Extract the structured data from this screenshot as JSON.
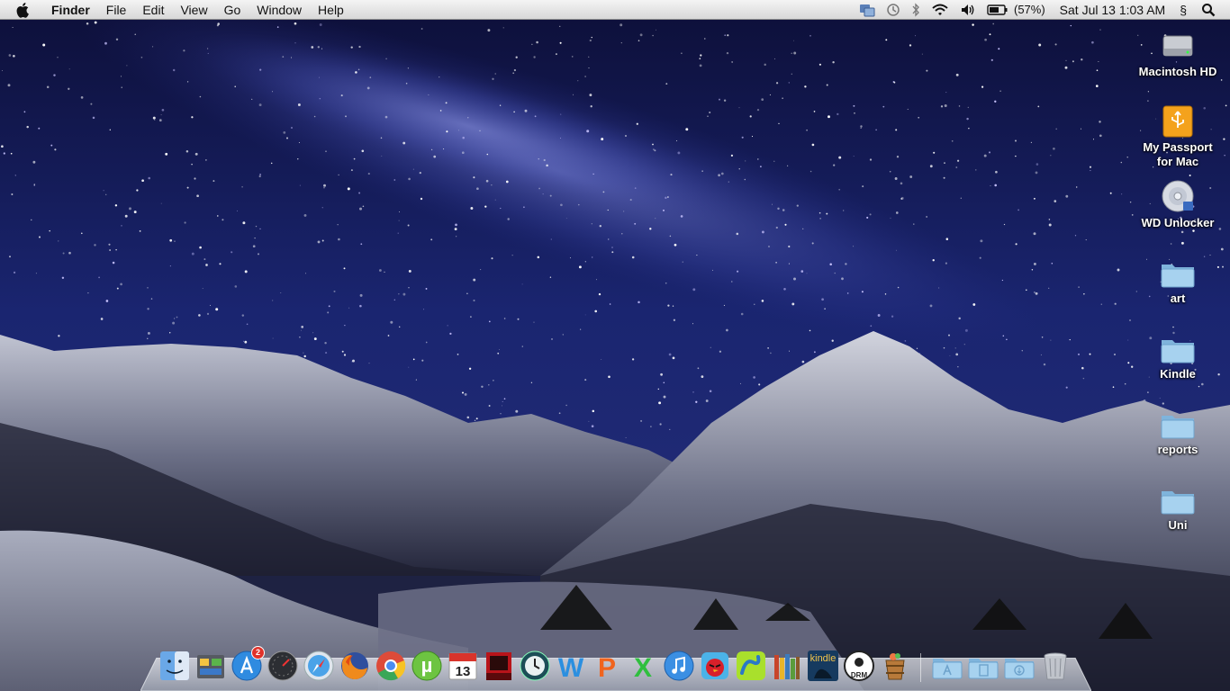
{
  "menubar": {
    "app_name": "Finder",
    "menus": [
      "File",
      "Edit",
      "View",
      "Go",
      "Window",
      "Help"
    ],
    "status": {
      "battery": "(57%)",
      "datetime": "Sat Jul 13  1:03 AM",
      "input_symbol": "§"
    }
  },
  "desktop": {
    "icons": [
      {
        "label": "Macintosh HD",
        "icon": "hard-drive-icon"
      },
      {
        "label": "My Passport for Mac",
        "icon": "usb-drive-icon"
      },
      {
        "label": "WD Unlocker",
        "icon": "disc-icon"
      },
      {
        "label": "art",
        "icon": "folder-icon"
      },
      {
        "label": "Kindle",
        "icon": "folder-icon"
      },
      {
        "label": "reports",
        "icon": "folder-icon"
      },
      {
        "label": "Uni",
        "icon": "folder-icon"
      }
    ]
  },
  "dock": {
    "apps": [
      {
        "name": "finder-icon"
      },
      {
        "name": "utilities-icon"
      },
      {
        "name": "app-store-icon",
        "badge": "2"
      },
      {
        "name": "dashboard-icon"
      },
      {
        "name": "safari-icon"
      },
      {
        "name": "firefox-icon"
      },
      {
        "name": "chrome-icon"
      },
      {
        "name": "utorrent-icon",
        "glyph": "µ"
      },
      {
        "name": "calendar-icon",
        "glyph": "13"
      },
      {
        "name": "photo-booth-icon"
      },
      {
        "name": "time-machine-icon"
      },
      {
        "name": "word-icon",
        "glyph": "W"
      },
      {
        "name": "powerpoint-icon",
        "glyph": "P"
      },
      {
        "name": "excel-icon",
        "glyph": "X"
      },
      {
        "name": "itunes-icon"
      },
      {
        "name": "angry-birds-icon"
      },
      {
        "name": "skitch-icon"
      },
      {
        "name": "ibooks-icon"
      },
      {
        "name": "kindle-icon",
        "glyph": "kindle"
      },
      {
        "name": "drm-removal-icon",
        "glyph": "DRM"
      },
      {
        "name": "bucket-icon"
      }
    ],
    "stacks": [
      {
        "name": "applications-stack-icon"
      },
      {
        "name": "documents-stack-icon"
      },
      {
        "name": "downloads-stack-icon"
      },
      {
        "name": "trash-icon"
      }
    ]
  },
  "colors": {
    "sky_top": "#151748",
    "sky_mid": "#1b2a78",
    "mountain": "#4b4f63",
    "snow": "#c9ccd8",
    "folder": "#9ccbe8"
  }
}
